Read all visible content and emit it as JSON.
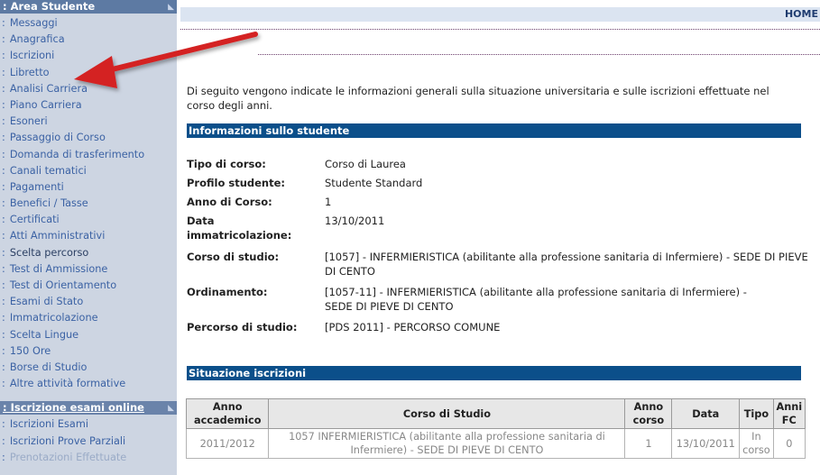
{
  "sidebar": {
    "section1_title": ": Area Studente",
    "items": [
      {
        "label": "Messaggi",
        "style": "normal"
      },
      {
        "label": "Anagrafica",
        "style": "normal"
      },
      {
        "label": "Iscrizioni",
        "style": "normal"
      },
      {
        "label": "Libretto",
        "style": "normal"
      },
      {
        "label": "Analisi Carriera",
        "style": "normal"
      },
      {
        "label": "Piano Carriera",
        "style": "normal"
      },
      {
        "label": "Esoneri",
        "style": "normal"
      },
      {
        "label": "Passaggio di Corso",
        "style": "normal"
      },
      {
        "label": "Domanda di trasferimento",
        "style": "normal"
      },
      {
        "label": "Canali tematici",
        "style": "normal"
      },
      {
        "label": "Pagamenti",
        "style": "normal"
      },
      {
        "label": "Benefici / Tasse",
        "style": "normal"
      },
      {
        "label": "Certificati",
        "style": "normal"
      },
      {
        "label": "Atti Amministrativi",
        "style": "normal"
      },
      {
        "label": "Scelta percorso",
        "style": "dark"
      },
      {
        "label": "Test di Ammissione",
        "style": "normal"
      },
      {
        "label": "Test di Orientamento",
        "style": "normal"
      },
      {
        "label": "Esami di Stato",
        "style": "normal"
      },
      {
        "label": "Immatricolazione",
        "style": "normal"
      },
      {
        "label": "Scelta Lingue",
        "style": "normal"
      },
      {
        "label": "150 Ore",
        "style": "normal"
      },
      {
        "label": "Borse di Studio",
        "style": "normal"
      },
      {
        "label": "Altre attività formative",
        "style": "normal"
      }
    ],
    "section2_title": ": Iscrizione esami online",
    "items2": [
      {
        "label": "Iscrizioni Esami",
        "style": "normal"
      },
      {
        "label": "Iscrizioni Prove Parziali",
        "style": "normal"
      },
      {
        "label": "Prenotazioni Effettuate",
        "style": "fade"
      }
    ]
  },
  "header": {
    "home_label": "HOME"
  },
  "intro_text": "Di seguito vengono indicate le informazioni generali sulla situazione universitaria e sulle iscrizioni effettuate nel corso degli anni.",
  "student_info": {
    "section_title": "Informazioni sullo studente",
    "rows": [
      {
        "label": "Tipo di corso:",
        "value": "Corso di Laurea"
      },
      {
        "label": "Profilo studente:",
        "value": "Studente Standard"
      },
      {
        "label": "Anno di Corso:",
        "value": "1"
      },
      {
        "label": "Data immatricolazione:",
        "value": "13/10/2011"
      },
      {
        "label": "Corso di studio:",
        "value": "[1057] - INFERMIERISTICA (abilitante alla professione sanitaria di Infermiere) - SEDE DI PIEVE DI CENTO"
      },
      {
        "label": "Ordinamento:",
        "value": "[1057-11] - INFERMIERISTICA (abilitante alla professione sanitaria di Infermiere) - SEDE DI PIEVE DI CENTO"
      },
      {
        "label": "Percorso di studio:",
        "value": "[PDS 2011] - PERCORSO COMUNE"
      }
    ]
  },
  "iscrizioni": {
    "section_title": "Situazione iscrizioni",
    "columns": [
      "Anno accademico",
      "Corso di Studio",
      "Anno corso",
      "Data",
      "Tipo",
      "Anni FC"
    ],
    "rows": [
      [
        "2011/2012",
        "1057 INFERMIERISTICA (abilitante alla professione sanitaria di Infermiere) - SEDE DI PIEVE DI CENTO",
        "1",
        "13/10/2011",
        "In corso",
        "0"
      ]
    ]
  },
  "colors": {
    "sidebar_bg": "#cdd5e2",
    "sidebar_link": "#3b62a4",
    "section_bar": "#0b4f8a",
    "arrow": "#d42020"
  }
}
